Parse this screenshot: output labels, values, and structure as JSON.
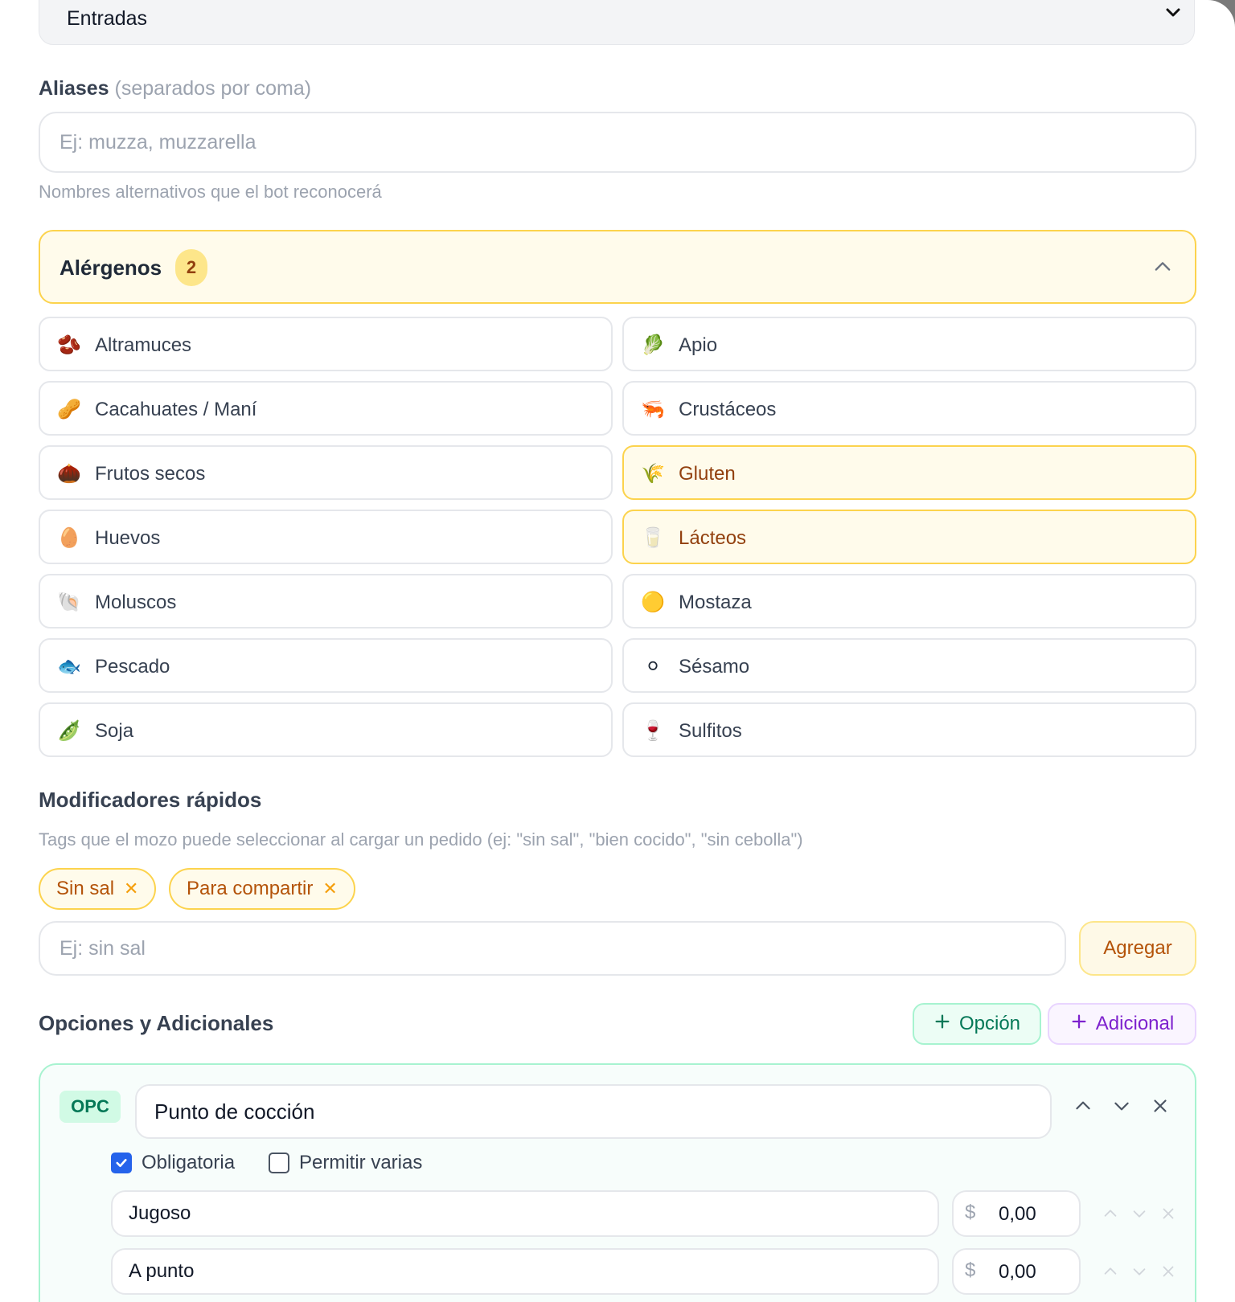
{
  "category": {
    "selected": "Entradas"
  },
  "aliases": {
    "label": "Aliases",
    "label_note": "(separados por coma)",
    "placeholder": "Ej: muzza, muzzarella",
    "hint": "Nombres alternativos que el bot reconocerá"
  },
  "allergens": {
    "title": "Alérgenos",
    "count": "2",
    "items": [
      {
        "label": "Altramuces",
        "icon": "🫘",
        "selected": false
      },
      {
        "label": "Apio",
        "icon": "🥬",
        "selected": false
      },
      {
        "label": "Cacahuates / Maní",
        "icon": "🥜",
        "selected": false
      },
      {
        "label": "Crustáceos",
        "icon": "🦐",
        "selected": false
      },
      {
        "label": "Frutos secos",
        "icon": "🌰",
        "selected": false
      },
      {
        "label": "Gluten",
        "icon": "🌾",
        "selected": true
      },
      {
        "label": "Huevos",
        "icon": "🥚",
        "selected": false
      },
      {
        "label": "Lácteos",
        "icon": "🥛",
        "selected": true
      },
      {
        "label": "Moluscos",
        "icon": "🐚",
        "selected": false
      },
      {
        "label": "Mostaza",
        "icon": "🟡",
        "selected": false
      },
      {
        "label": "Pescado",
        "icon": "🐟",
        "selected": false
      },
      {
        "label": "Sésamo",
        "icon": "⚪",
        "selected": false
      },
      {
        "label": "Soja",
        "icon": "🫛",
        "selected": false
      },
      {
        "label": "Sulfitos",
        "icon": "🍷",
        "selected": false
      }
    ]
  },
  "modifiers": {
    "title": "Modificadores rápidos",
    "hint": "Tags que el mozo puede seleccionar al cargar un pedido (ej: \"sin sal\", \"bien cocido\", \"sin cebolla\")",
    "tags": [
      "Sin sal",
      "Para compartir"
    ],
    "placeholder": "Ej: sin sal",
    "add_label": "Agregar"
  },
  "options": {
    "title": "Opciones y Adicionales",
    "add_option_label": "Opción",
    "add_extra_label": "Adicional",
    "group": {
      "badge": "OPC",
      "name": "Punto de cocción",
      "required_label": "Obligatoria",
      "required": true,
      "multiple_label": "Permitir varias",
      "multiple": false,
      "currency": "$",
      "rows": [
        {
          "name": "Jugoso",
          "price": "0,00"
        },
        {
          "name": "A punto",
          "price": "0,00"
        }
      ]
    }
  },
  "colors": {
    "accent_amber": "#fcd34d",
    "accent_green": "#a7f3d0",
    "accent_purple": "#e9d5ff",
    "checkbox_blue": "#2563eb"
  }
}
